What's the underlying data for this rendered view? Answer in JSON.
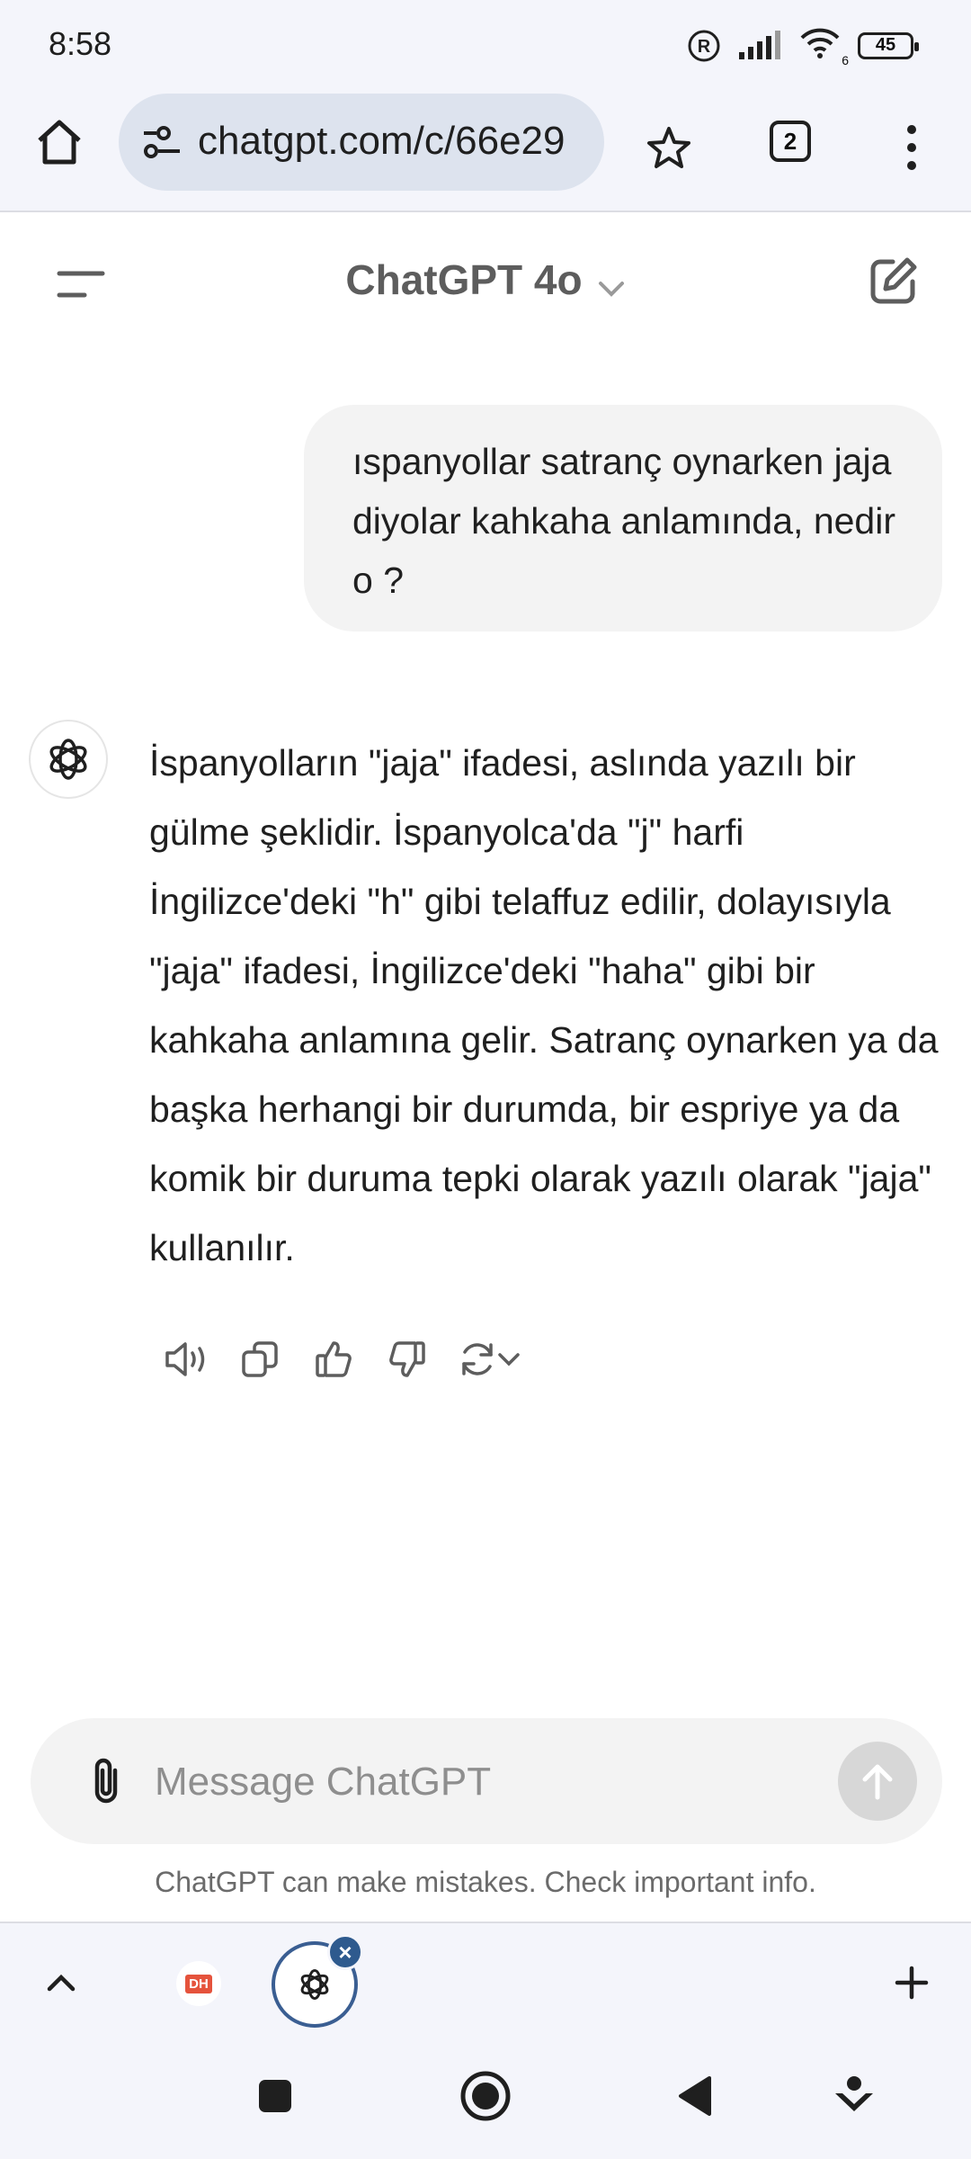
{
  "status_bar": {
    "time": "8:58",
    "battery": "45",
    "network_label": "6"
  },
  "browser": {
    "url": "chatgpt.com/c/66e29",
    "tab_count": "2"
  },
  "header": {
    "model_name": "ChatGPT 4o"
  },
  "conversation": {
    "user_message": "ıspanyollar satranç oynarken jaja diyolar kahkaha anlamında, nedir o ?",
    "assistant_message": "İspanyolların \"jaja\" ifadesi, aslında yazılı bir gülme şeklidir. İspanyolca'da \"j\" harfi İngilizce'deki \"h\" gibi telaffuz edilir, dolayısıyla \"jaja\" ifadesi, İngilizce'deki \"haha\" gibi bir kahkaha anlamına gelir. Satranç oynarken ya da başka herhangi bir durumda, bir espriye ya da komik bir duruma tepki olarak yazılı olarak \"jaja\" kullanılır."
  },
  "composer": {
    "placeholder": "Message ChatGPT",
    "value": ""
  },
  "disclaimer": "ChatGPT can make mistakes. Check important info.",
  "tab_strip": {
    "tab1_favicon_text": "DH"
  },
  "icons": {
    "home": "home-icon",
    "site_settings": "site-settings-icon",
    "bookmark": "star-icon",
    "menu": "kebab-menu-icon",
    "sidebar": "sidebar-menu-icon",
    "new_chat": "new-chat-icon",
    "read_aloud": "speaker-icon",
    "copy": "copy-icon",
    "like": "thumbs-up-icon",
    "dislike": "thumbs-down-icon",
    "regenerate": "regenerate-icon",
    "attach": "paperclip-icon",
    "send": "arrow-up-icon"
  },
  "colors": {
    "accent_tab_ring": "#3a5e92",
    "bubble": "#f3f3f3",
    "browser_chrome": "#f4f5fb"
  }
}
